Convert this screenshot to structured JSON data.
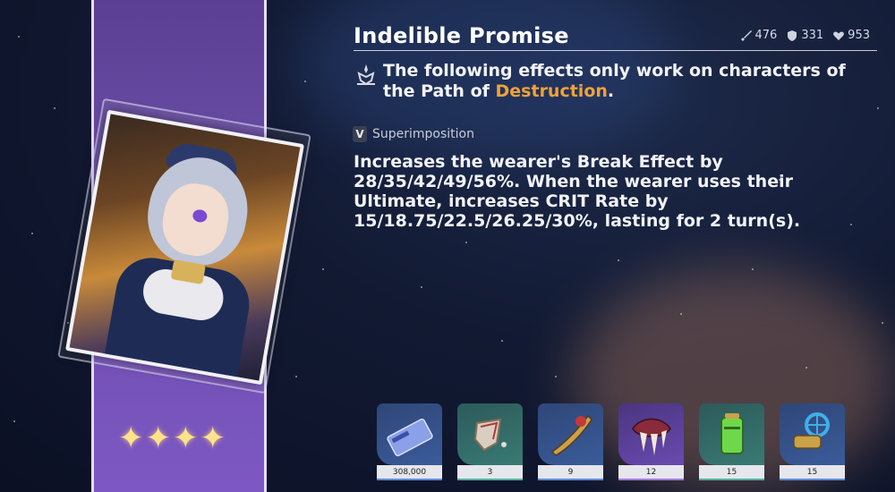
{
  "light_cone": {
    "name": "Indelible Promise",
    "rarity_stars": 4,
    "stats": [
      {
        "icon": "sword-icon",
        "value": "476"
      },
      {
        "icon": "shield-icon",
        "value": "331"
      },
      {
        "icon": "heart-icon",
        "value": "953"
      }
    ],
    "path_notice_prefix": "The following effects only work on characters of the Path of ",
    "path_name": "Destruction",
    "path_notice_suffix": ".",
    "superimposition_level": "V",
    "superimposition_label": "Superimposition",
    "description": "Increases the wearer's Break Effect by 28/35/42/49/56%. When the wearer uses their Ultimate, increases CRIT Rate by 15/18.75/22.5/26.25/30%, lasting for 2 turn(s)."
  },
  "colors": {
    "rarity_band": "#6b4ea8",
    "path_highlight": "#f0a23a",
    "star": "#ffe38a"
  },
  "materials": [
    {
      "name": "credit-card-icon",
      "count": "308,000",
      "tier": "blue"
    },
    {
      "name": "shard-icon",
      "count": "3",
      "tier": "green"
    },
    {
      "name": "blade-icon",
      "count": "9",
      "tier": "blue"
    },
    {
      "name": "fang-icon",
      "count": "12",
      "tier": "purple"
    },
    {
      "name": "battery-icon",
      "count": "15",
      "tier": "green"
    },
    {
      "name": "gear-valve-icon",
      "count": "15",
      "tier": "blue"
    }
  ]
}
